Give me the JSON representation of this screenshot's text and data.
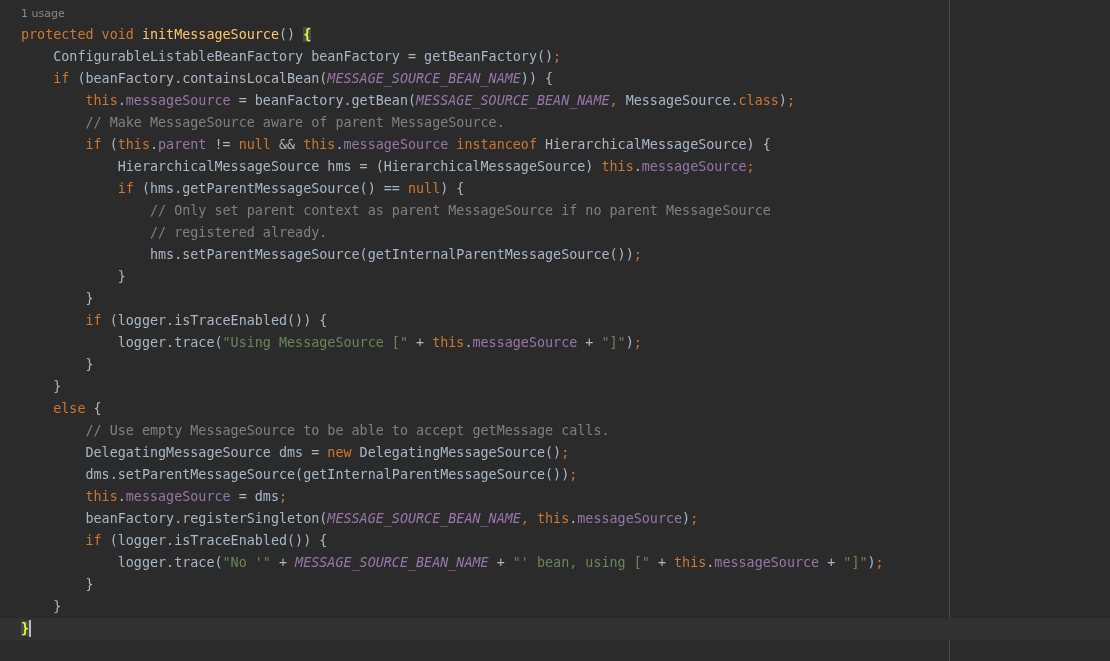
{
  "usages": "1 usage",
  "lines": [
    {
      "current": false,
      "tokens": [
        {
          "kind": "keyword",
          "text": "protected void "
        },
        {
          "kind": "declaration",
          "text": "initMessageSource"
        },
        {
          "kind": "plain",
          "text": "() "
        },
        {
          "kind": "matched_brace",
          "text": "{"
        }
      ]
    },
    {
      "current": false,
      "tokens": [
        {
          "kind": "plain",
          "text": "    ConfigurableListableBeanFactory beanFactory = getBeanFactory()"
        },
        {
          "kind": "keyword",
          "text": ";"
        }
      ]
    },
    {
      "current": false,
      "tokens": [
        {
          "kind": "keyword",
          "text": "    if "
        },
        {
          "kind": "plain",
          "text": "(beanFactory.containsLocalBean("
        },
        {
          "kind": "constant",
          "text": "MESSAGE_SOURCE_BEAN_NAME"
        },
        {
          "kind": "plain",
          "text": ")) {"
        }
      ]
    },
    {
      "current": false,
      "tokens": [
        {
          "kind": "keyword",
          "text": "        this"
        },
        {
          "kind": "plain",
          "text": "."
        },
        {
          "kind": "field",
          "text": "messageSource"
        },
        {
          "kind": "plain",
          "text": " = beanFactory.getBean("
        },
        {
          "kind": "constant",
          "text": "MESSAGE_SOURCE_BEAN_NAME"
        },
        {
          "kind": "keyword",
          "text": ", "
        },
        {
          "kind": "plain",
          "text": "MessageSource."
        },
        {
          "kind": "keyword",
          "text": "class"
        },
        {
          "kind": "plain",
          "text": ")"
        },
        {
          "kind": "keyword",
          "text": ";"
        }
      ]
    },
    {
      "current": false,
      "tokens": [
        {
          "kind": "comment",
          "text": "        // Make MessageSource aware of parent MessageSource."
        }
      ]
    },
    {
      "current": false,
      "tokens": [
        {
          "kind": "keyword",
          "text": "        if "
        },
        {
          "kind": "plain",
          "text": "("
        },
        {
          "kind": "keyword",
          "text": "this"
        },
        {
          "kind": "plain",
          "text": "."
        },
        {
          "kind": "field",
          "text": "parent"
        },
        {
          "kind": "plain",
          "text": " != "
        },
        {
          "kind": "keyword",
          "text": "null"
        },
        {
          "kind": "plain",
          "text": " && "
        },
        {
          "kind": "keyword",
          "text": "this"
        },
        {
          "kind": "plain",
          "text": "."
        },
        {
          "kind": "field",
          "text": "messageSource"
        },
        {
          "kind": "keyword",
          "text": " instanceof"
        },
        {
          "kind": "plain",
          "text": " HierarchicalMessageSource) {"
        }
      ]
    },
    {
      "current": false,
      "tokens": [
        {
          "kind": "plain",
          "text": "            HierarchicalMessageSource hms = (HierarchicalMessageSource) "
        },
        {
          "kind": "keyword",
          "text": "this"
        },
        {
          "kind": "plain",
          "text": "."
        },
        {
          "kind": "field",
          "text": "messageSource"
        },
        {
          "kind": "keyword",
          "text": ";"
        }
      ]
    },
    {
      "current": false,
      "tokens": [
        {
          "kind": "keyword",
          "text": "            if "
        },
        {
          "kind": "plain",
          "text": "(hms.getParentMessageSource() == "
        },
        {
          "kind": "keyword",
          "text": "null"
        },
        {
          "kind": "plain",
          "text": ") {"
        }
      ]
    },
    {
      "current": false,
      "tokens": [
        {
          "kind": "comment",
          "text": "                // Only set parent context as parent MessageSource if no parent MessageSource"
        }
      ]
    },
    {
      "current": false,
      "tokens": [
        {
          "kind": "comment",
          "text": "                // registered already."
        }
      ]
    },
    {
      "current": false,
      "tokens": [
        {
          "kind": "plain",
          "text": "                hms.setParentMessageSource(getInternalParentMessageSource())"
        },
        {
          "kind": "keyword",
          "text": ";"
        }
      ]
    },
    {
      "current": false,
      "tokens": [
        {
          "kind": "plain",
          "text": "            }"
        }
      ]
    },
    {
      "current": false,
      "tokens": [
        {
          "kind": "plain",
          "text": "        }"
        }
      ]
    },
    {
      "current": false,
      "tokens": [
        {
          "kind": "keyword",
          "text": "        if "
        },
        {
          "kind": "plain",
          "text": "(logger.isTraceEnabled()) {"
        }
      ]
    },
    {
      "current": false,
      "tokens": [
        {
          "kind": "plain",
          "text": "            logger.trace("
        },
        {
          "kind": "string",
          "text": "\"Using MessageSource [\""
        },
        {
          "kind": "plain",
          "text": " + "
        },
        {
          "kind": "keyword",
          "text": "this"
        },
        {
          "kind": "plain",
          "text": "."
        },
        {
          "kind": "field",
          "text": "messageSource"
        },
        {
          "kind": "plain",
          "text": " + "
        },
        {
          "kind": "string",
          "text": "\"]\""
        },
        {
          "kind": "plain",
          "text": ")"
        },
        {
          "kind": "keyword",
          "text": ";"
        }
      ]
    },
    {
      "current": false,
      "tokens": [
        {
          "kind": "plain",
          "text": "        }"
        }
      ]
    },
    {
      "current": false,
      "tokens": [
        {
          "kind": "plain",
          "text": "    }"
        }
      ]
    },
    {
      "current": false,
      "tokens": [
        {
          "kind": "keyword",
          "text": "    else "
        },
        {
          "kind": "plain",
          "text": "{"
        }
      ]
    },
    {
      "current": false,
      "tokens": [
        {
          "kind": "comment",
          "text": "        // Use empty MessageSource to be able to accept getMessage calls."
        }
      ]
    },
    {
      "current": false,
      "tokens": [
        {
          "kind": "plain",
          "text": "        DelegatingMessageSource dms = "
        },
        {
          "kind": "keyword",
          "text": "new "
        },
        {
          "kind": "plain",
          "text": "DelegatingMessageSource()"
        },
        {
          "kind": "keyword",
          "text": ";"
        }
      ]
    },
    {
      "current": false,
      "tokens": [
        {
          "kind": "plain",
          "text": "        dms.setParentMessageSource(getInternalParentMessageSource())"
        },
        {
          "kind": "keyword",
          "text": ";"
        }
      ]
    },
    {
      "current": false,
      "tokens": [
        {
          "kind": "keyword",
          "text": "        this"
        },
        {
          "kind": "plain",
          "text": "."
        },
        {
          "kind": "field",
          "text": "messageSource"
        },
        {
          "kind": "plain",
          "text": " = dms"
        },
        {
          "kind": "keyword",
          "text": ";"
        }
      ]
    },
    {
      "current": false,
      "tokens": [
        {
          "kind": "plain",
          "text": "        beanFactory.registerSingleton("
        },
        {
          "kind": "constant",
          "text": "MESSAGE_SOURCE_BEAN_NAME"
        },
        {
          "kind": "keyword",
          "text": ", this"
        },
        {
          "kind": "plain",
          "text": "."
        },
        {
          "kind": "field",
          "text": "messageSource"
        },
        {
          "kind": "plain",
          "text": ")"
        },
        {
          "kind": "keyword",
          "text": ";"
        }
      ]
    },
    {
      "current": false,
      "tokens": [
        {
          "kind": "keyword",
          "text": "        if "
        },
        {
          "kind": "plain",
          "text": "(logger.isTraceEnabled()) {"
        }
      ]
    },
    {
      "current": false,
      "tokens": [
        {
          "kind": "plain",
          "text": "            logger.trace("
        },
        {
          "kind": "string",
          "text": "\"No '\""
        },
        {
          "kind": "plain",
          "text": " + "
        },
        {
          "kind": "constant",
          "text": "MESSAGE_SOURCE_BEAN_NAME"
        },
        {
          "kind": "plain",
          "text": " + "
        },
        {
          "kind": "string",
          "text": "\"' bean, using [\""
        },
        {
          "kind": "plain",
          "text": " + "
        },
        {
          "kind": "keyword",
          "text": "this"
        },
        {
          "kind": "plain",
          "text": "."
        },
        {
          "kind": "field",
          "text": "messageSource"
        },
        {
          "kind": "plain",
          "text": " + "
        },
        {
          "kind": "string",
          "text": "\"]\""
        },
        {
          "kind": "plain",
          "text": ")"
        },
        {
          "kind": "keyword",
          "text": ";"
        }
      ]
    },
    {
      "current": false,
      "tokens": [
        {
          "kind": "plain",
          "text": "        }"
        }
      ]
    },
    {
      "current": false,
      "tokens": [
        {
          "kind": "plain",
          "text": "    }"
        }
      ]
    },
    {
      "current": true,
      "tokens": [
        {
          "kind": "matched_brace",
          "text": "}"
        }
      ]
    }
  ]
}
